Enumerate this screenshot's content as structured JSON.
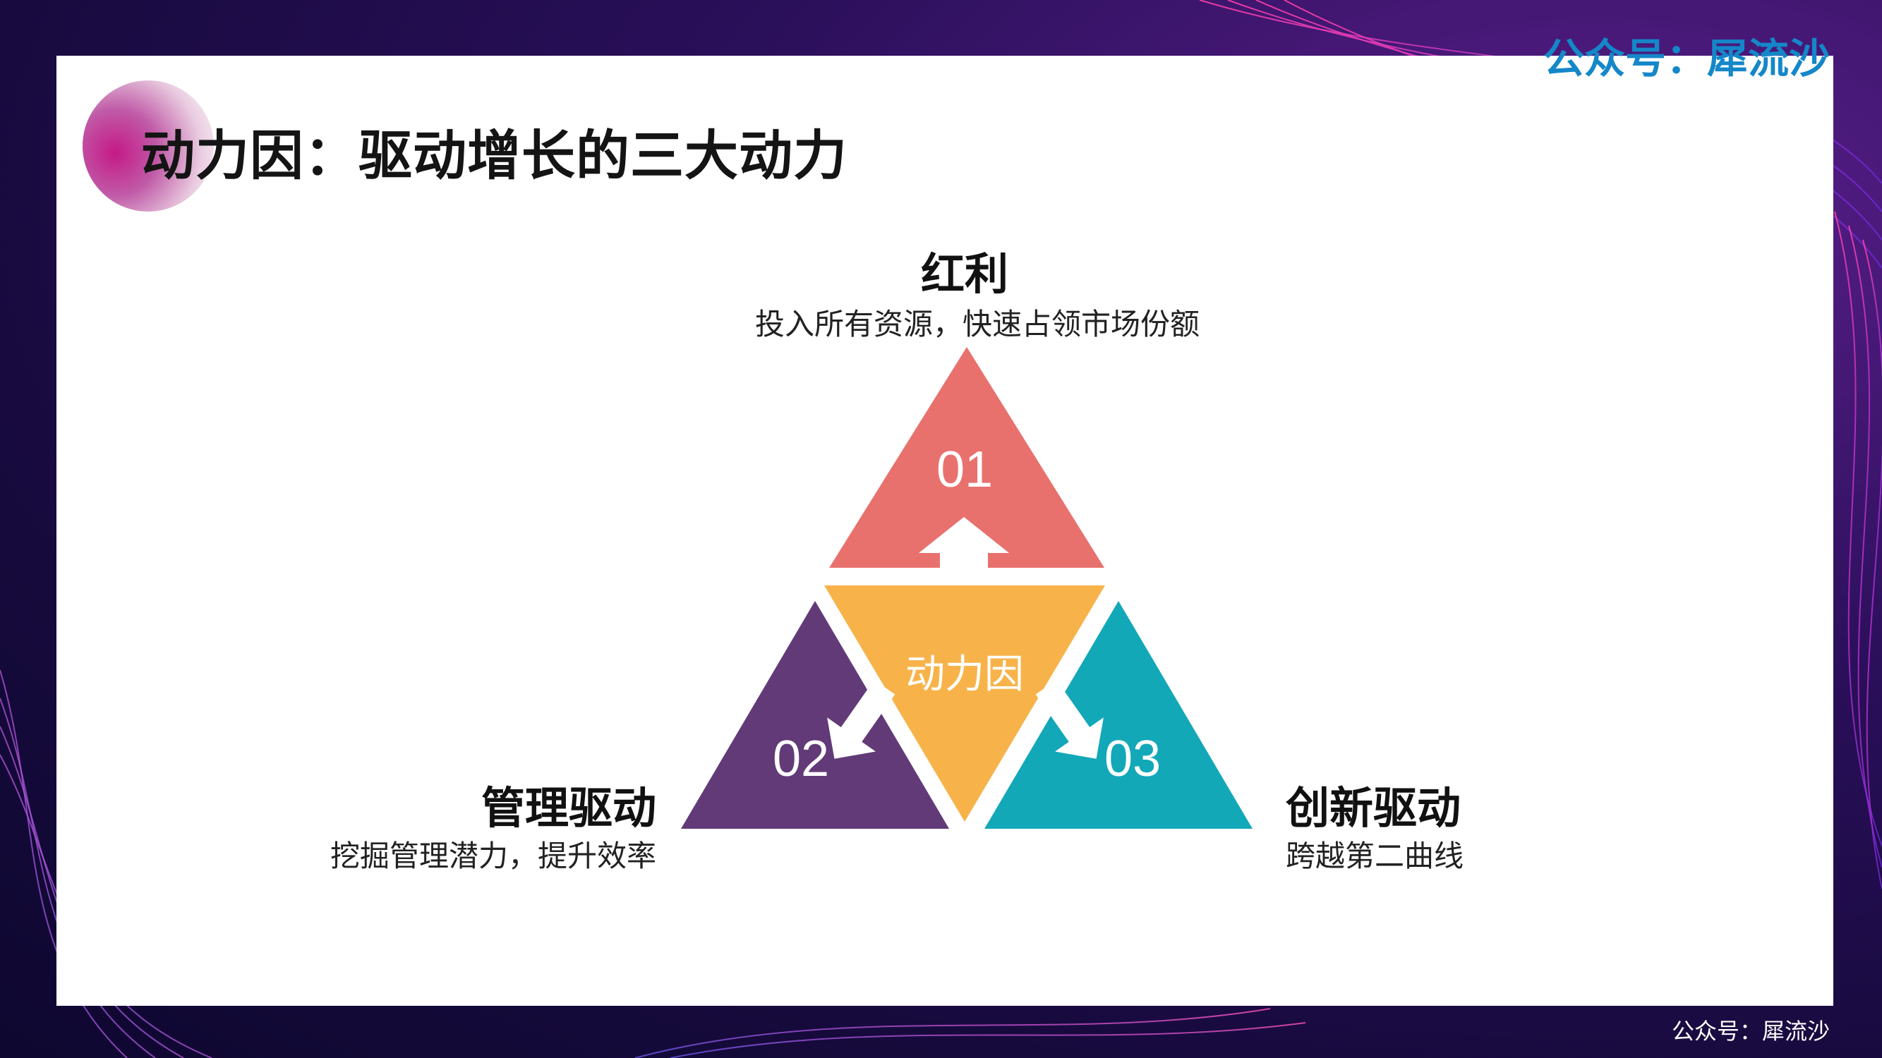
{
  "title": "动力因：驱动增长的三大动力",
  "watermark_top": "公众号：犀流沙",
  "watermark_bottom": "公众号：犀流沙",
  "colors": {
    "top_triangle": "#e8716e",
    "left_triangle": "#623a78",
    "right_triangle": "#13a8b8",
    "center_triangle": "#f7b34a",
    "title_circle": "#c51a86"
  },
  "diagram": {
    "center_label": "动力因",
    "nodes": [
      {
        "number": "01",
        "title": "红利",
        "description": "投入所有资源，快速占领市场份额"
      },
      {
        "number": "02",
        "title": "管理驱动",
        "description": "挖掘管理潜力，提升效率"
      },
      {
        "number": "03",
        "title": "创新驱动",
        "description": "跨越第二曲线"
      }
    ]
  }
}
